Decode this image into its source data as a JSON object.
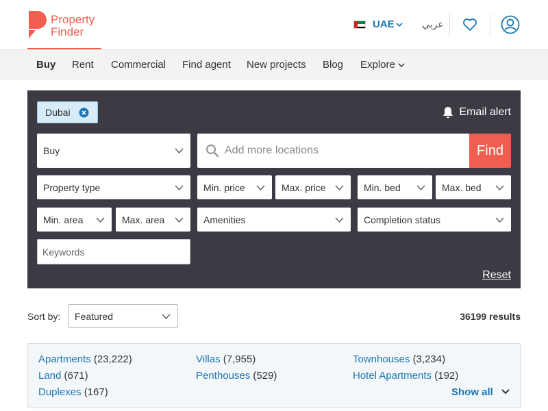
{
  "brand": {
    "line1": "Property",
    "line2": "Finder",
    "color": "#ef5e4e"
  },
  "header": {
    "country": "UAE",
    "language": "عربي"
  },
  "nav": {
    "items": [
      {
        "label": "Buy"
      },
      {
        "label": "Rent"
      },
      {
        "label": "Commercial"
      },
      {
        "label": "Find agent"
      },
      {
        "label": "New projects"
      },
      {
        "label": "Blog"
      },
      {
        "label": "Explore"
      }
    ]
  },
  "search": {
    "chip": "Dubai",
    "email_alert": "Email alert",
    "purpose": "Buy",
    "location_placeholder": "Add more locations",
    "find": "Find",
    "property_type": "Property type",
    "min_price": "Min. price",
    "max_price": "Max. price",
    "min_bed": "Min. bed",
    "max_bed": "Max. bed",
    "min_area": "Min. area",
    "max_area": "Max. area",
    "amenities": "Amenities",
    "completion": "Completion status",
    "keywords_placeholder": "Keywords",
    "reset": "Reset"
  },
  "results": {
    "sort_label": "Sort by:",
    "sort_value": "Featured",
    "count": "36199 results"
  },
  "categories": {
    "items": [
      {
        "name": "Apartments",
        "count": "(23,222)"
      },
      {
        "name": "Villas",
        "count": "(7,955)"
      },
      {
        "name": "Townhouses",
        "count": "(3,234)"
      },
      {
        "name": "Land",
        "count": "(671)"
      },
      {
        "name": "Penthouses",
        "count": "(529)"
      },
      {
        "name": "Hotel Apartments",
        "count": "(192)"
      },
      {
        "name": "Duplexes",
        "count": "(167)"
      }
    ],
    "show_all": "Show all"
  }
}
